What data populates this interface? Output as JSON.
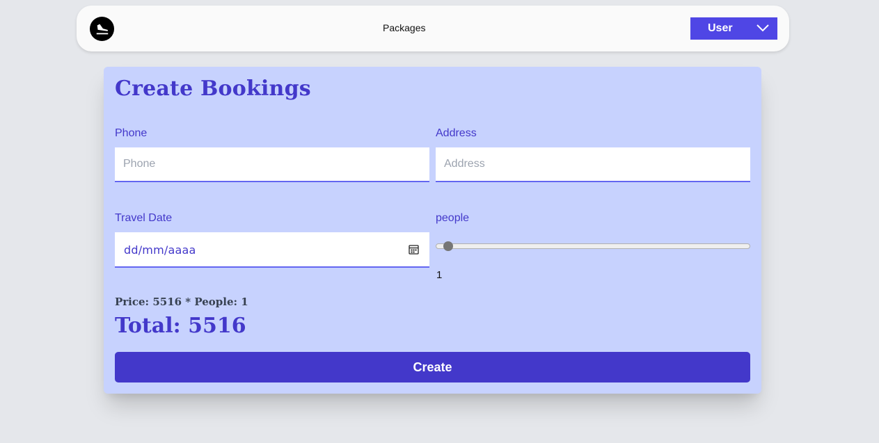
{
  "navbar": {
    "logo_icon": "airplane-landing-icon",
    "links": [
      "Packages"
    ],
    "user_menu_label": "User",
    "user_menu_icon": "chevron-down-icon"
  },
  "form": {
    "title": "Create Bookings",
    "phone": {
      "label": "Phone",
      "placeholder": "Phone",
      "value": ""
    },
    "address": {
      "label": "Address",
      "placeholder": "Address",
      "value": ""
    },
    "travel_date": {
      "label": "Travel Date",
      "display": "dd/mm/aaaa",
      "icon": "calendar-icon"
    },
    "people": {
      "label": "people",
      "value": "1",
      "min": 1,
      "max": 40,
      "level": 0.0
    },
    "price_line": "Price: 5516 * People: 1",
    "total_line": "Total: 5516",
    "submit_label": "Create"
  },
  "colors": {
    "accent": "#4338ca",
    "button": "#4f46e5",
    "card_bg": "#c7d2fe",
    "page_bg": "#e5e7eb"
  }
}
